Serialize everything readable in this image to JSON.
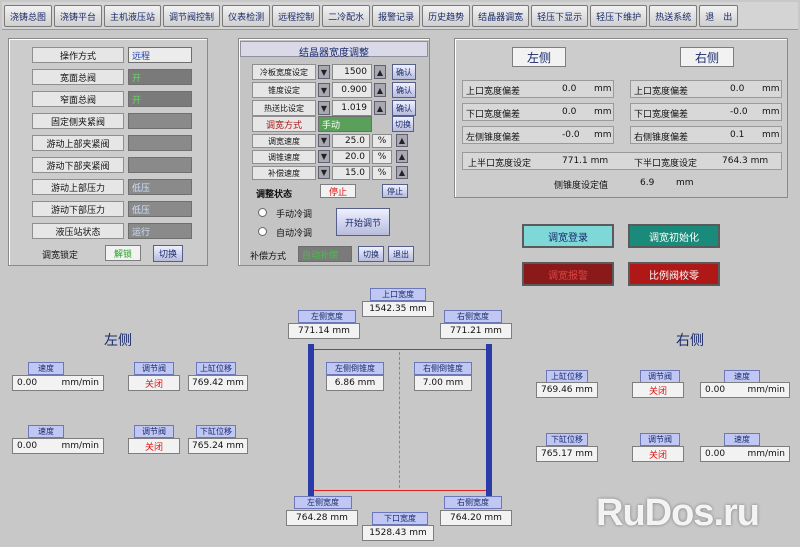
{
  "nav": [
    "浇铸总图",
    "浇铸平台",
    "主机液压站",
    "调节阀控制",
    "仪表检测",
    "远程控制",
    "二冷配水",
    "报警记录",
    "历史趋势",
    "结晶器调宽",
    "轻压下显示",
    "轻压下维护",
    "热送系统",
    "退　出"
  ],
  "left_panel": {
    "rows": [
      {
        "label": "操作方式",
        "value": "远程",
        "style": "light"
      },
      {
        "label": "宽面总阀",
        "value": "开",
        "style": "green"
      },
      {
        "label": "窄面总阀",
        "value": "开",
        "style": "green"
      },
      {
        "label": "固定侧夹紧阀",
        "value": "",
        "style": "dark"
      },
      {
        "label": "游动上部夹紧阀",
        "value": "",
        "style": "dark"
      },
      {
        "label": "游动下部夹紧阀",
        "value": "",
        "style": "dark"
      },
      {
        "label": "游动上部压力",
        "value": "低压",
        "style": "blue"
      },
      {
        "label": "游动下部压力",
        "value": "低压",
        "style": "blue"
      },
      {
        "label": "液压站状态",
        "value": "运行",
        "style": "blue"
      }
    ],
    "lock_label": "调宽锁定",
    "lock_value": "解锁",
    "switch_btn": "切换"
  },
  "center_panel": {
    "title": "结晶器宽度调整",
    "set_rows": [
      {
        "label": "冷板宽度设定",
        "value": "1500",
        "btn": "确认"
      },
      {
        "label": "锥度设定",
        "value": "0.900",
        "btn": "确认"
      },
      {
        "label": "热送比设定",
        "value": "1.019",
        "btn": "确认"
      }
    ],
    "mode_label": "调宽方式",
    "mode_value": "手动",
    "mode_btn": "切换",
    "speed_rows": [
      {
        "label": "调宽速度",
        "value": "25.0",
        "unit": "%"
      },
      {
        "label": "调锥速度",
        "value": "20.0",
        "unit": "%"
      },
      {
        "label": "补偿速度",
        "value": "15.0",
        "unit": "%"
      }
    ],
    "state_label": "调整状态",
    "state_value": "停止",
    "stop_btn": "停止",
    "radio_manual": "手动冷调",
    "radio_auto": "自动冷调",
    "start_btn": "开始调节",
    "comp_label": "补偿方式",
    "comp_value": "自动补偿",
    "comp_btn": "切换",
    "exit_btn": "退出"
  },
  "right_panel": {
    "left_title": "左侧",
    "right_title": "右侧",
    "left_rows": [
      {
        "label": "上口宽度偏差",
        "value": "0.0",
        "unit": "mm"
      },
      {
        "label": "下口宽度偏差",
        "value": "0.0",
        "unit": "mm"
      },
      {
        "label": "左侧锥度偏差",
        "value": "-0.0",
        "unit": "mm"
      }
    ],
    "right_rows": [
      {
        "label": "上口宽度偏差",
        "value": "0.0",
        "unit": "mm"
      },
      {
        "label": "下口宽度偏差",
        "value": "-0.0",
        "unit": "mm"
      },
      {
        "label": "右侧锥度偏差",
        "value": "0.1",
        "unit": "mm"
      }
    ],
    "upper_set_label": "上半口宽度设定",
    "upper_set_value": "771.1 mm",
    "lower_set_label": "下半口宽度设定",
    "lower_set_value": "764.3 mm",
    "taper_label": "侧锥度设定值",
    "taper_value": "6.9",
    "taper_unit": "mm"
  },
  "action_buttons": {
    "login": "调宽登录",
    "init": "调宽初始化",
    "alarm": "调宽报警",
    "zero": "比例阀校零"
  },
  "diagram": {
    "side_left": "左侧",
    "side_right": "右侧",
    "upper_width_label": "上口宽度",
    "upper_width_value": "1542.35 mm",
    "lower_width_label": "下口宽度",
    "lower_width_value": "1528.43 mm",
    "left_top_label": "左侧宽度",
    "left_top_value": "771.14 mm",
    "right_top_label": "右侧宽度",
    "right_top_value": "771.21 mm",
    "left_bot_label": "左侧宽度",
    "left_bot_value": "764.28 mm",
    "right_bot_label": "右侧宽度",
    "right_bot_value": "764.20 mm",
    "left_taper_label": "左侧倒锥度",
    "left_taper_value": "6.86 mm",
    "right_taper_label": "右侧倒锥度",
    "right_taper_value": "7.00 mm"
  },
  "left_cyl": {
    "upper": {
      "speed_label": "速度",
      "speed_value": "0.00",
      "speed_unit": "mm/min",
      "valve_label": "调节阀",
      "valve_value": "关闭",
      "pos_label": "上缸位移",
      "pos_value": "769.42 mm"
    },
    "lower": {
      "speed_label": "速度",
      "speed_value": "0.00",
      "speed_unit": "mm/min",
      "valve_label": "调节阀",
      "valve_value": "关闭",
      "pos_label": "下缸位移",
      "pos_value": "765.24 mm"
    }
  },
  "right_cyl": {
    "upper": {
      "pos_label": "上缸位移",
      "pos_value": "769.46 mm",
      "valve_label": "调节阀",
      "valve_value": "关闭",
      "speed_label": "速度",
      "speed_value": "0.00",
      "speed_unit": "mm/min"
    },
    "lower": {
      "pos_label": "下缸位移",
      "pos_value": "765.17 mm",
      "valve_label": "调节阀",
      "valve_value": "关闭",
      "speed_label": "速度",
      "speed_value": "0.00",
      "speed_unit": "mm/min"
    }
  },
  "watermark": "RuDos.ru",
  "colors": {
    "cyan_btn": "#7fd8d8",
    "teal_btn": "#1a8a7a",
    "red_btn": "#8a1a1a",
    "red_btn2": "#b01818",
    "blue_post": "#2a3aa8",
    "red_line": "#e02020"
  }
}
